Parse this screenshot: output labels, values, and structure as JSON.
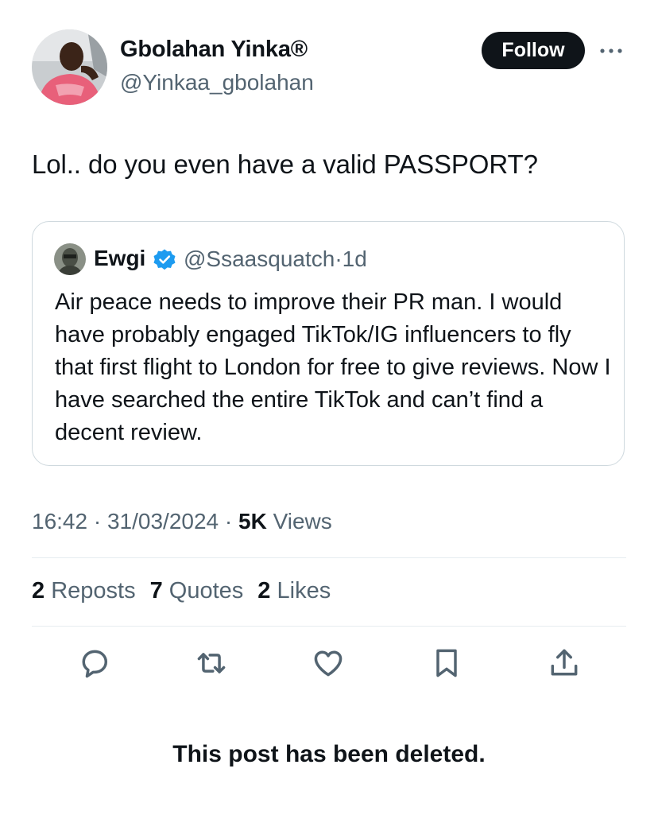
{
  "author": {
    "name": "Gbolahan Yinka®",
    "handle": "@Yinkaa_gbolahan",
    "follow_label": "Follow"
  },
  "tweet": {
    "text": "Lol.. do you even have a valid PASSPORT?"
  },
  "quote": {
    "name": "Ewgi",
    "handle": "@Ssaasquatch",
    "separator": "·",
    "age": "1d",
    "text": "Air peace needs to improve their PR man. I would have probably engaged TikTok/IG influencers to fly that first flight to London for free to give reviews. Now I have searched the entire TikTok and can’t find a decent review."
  },
  "meta": {
    "time": "16:42",
    "date": "31/03/2024",
    "views_count": "5K",
    "views_label": "Views"
  },
  "stats": {
    "reposts_count": "2",
    "reposts_label": "Reposts",
    "quotes_count": "7",
    "quotes_label": "Quotes",
    "likes_count": "2",
    "likes_label": "Likes"
  },
  "actions": [
    "reply-icon",
    "repost-icon",
    "like-icon",
    "bookmark-icon",
    "share-icon"
  ],
  "notice": {
    "deleted": "This post has been deleted."
  },
  "colors": {
    "text_primary": "#0f1419",
    "text_secondary": "#536471",
    "verified_blue": "#1d9bf0",
    "border": "#cfd9de"
  }
}
